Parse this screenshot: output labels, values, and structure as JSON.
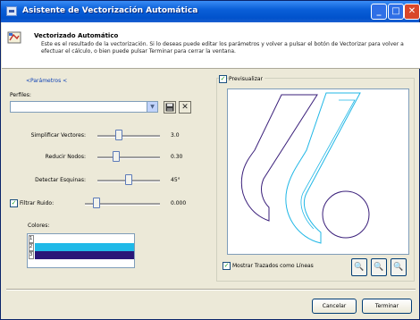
{
  "window": {
    "title": "Asistente de Vectorización Automática",
    "min_glyph": "_",
    "max_glyph": "□",
    "close_glyph": "✕"
  },
  "header": {
    "title": "Vectorizado Automático",
    "description": "Este es el resultado de la vectorización. Si lo deseas puede editar los parámetros y volver a pulsar el botón de Vectorizar para volver a efectuar el cálculo, o bien puede pulsar Terminar para cerrar la ventana."
  },
  "params": {
    "link_text": "<Parámetros <",
    "profiles_label": "Perfiles:",
    "profile_value": "",
    "sliders": [
      {
        "label": "Simplificar Vectores:",
        "value_text": "3.0",
        "level": 0.32
      },
      {
        "label": "Reducir Nodos:",
        "value_text": "0.30",
        "level": 0.28
      },
      {
        "label": "Detectar Esquinas:",
        "value_text": "45°",
        "level": 0.5
      },
      {
        "label": "Filtrar Ruido:",
        "value_text": "0.000",
        "level": 0.12
      }
    ],
    "filter_checked": true,
    "colors_label": "Colores:",
    "colors": [
      "#ffffff",
      "#1fb9e8",
      "#2a1678"
    ],
    "color_indices": [
      "1",
      "2",
      "3"
    ]
  },
  "preview": {
    "label": "Previsualizar",
    "checked": true,
    "show_lines_label": "Mostrar Trazados como Líneas",
    "show_lines_checked": true,
    "stroke_colors": [
      "#3a1f7a",
      "#20b7e6"
    ]
  },
  "buttons": {
    "cancel": "Cancelar",
    "finish": "Terminar"
  }
}
